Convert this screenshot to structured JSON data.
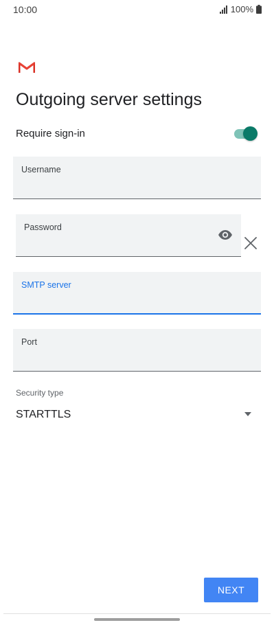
{
  "status_bar": {
    "time": "10:00",
    "battery_text": "100%",
    "signal_icon": "signal-bars-icon",
    "battery_icon": "battery-icon"
  },
  "app": {
    "logo_icon": "gmail-logo-icon"
  },
  "page": {
    "title": "Outgoing server settings"
  },
  "require_signin": {
    "label": "Require sign-in",
    "enabled": true,
    "accent_color": "#0a7a68"
  },
  "fields": {
    "username": {
      "label": "Username",
      "value": ""
    },
    "password": {
      "label": "Password",
      "value": "",
      "visibility_icon": "eye-icon",
      "clear_icon": "close-icon"
    },
    "smtp_server": {
      "label": "SMTP server",
      "value": "",
      "focused": true,
      "focus_color": "#1a73e8"
    },
    "port": {
      "label": "Port",
      "value": ""
    }
  },
  "security": {
    "label": "Security type",
    "selected": "STARTTLS",
    "dropdown_icon": "dropdown-arrow-icon"
  },
  "actions": {
    "next_label": "NEXT",
    "next_color": "#4285f4"
  }
}
